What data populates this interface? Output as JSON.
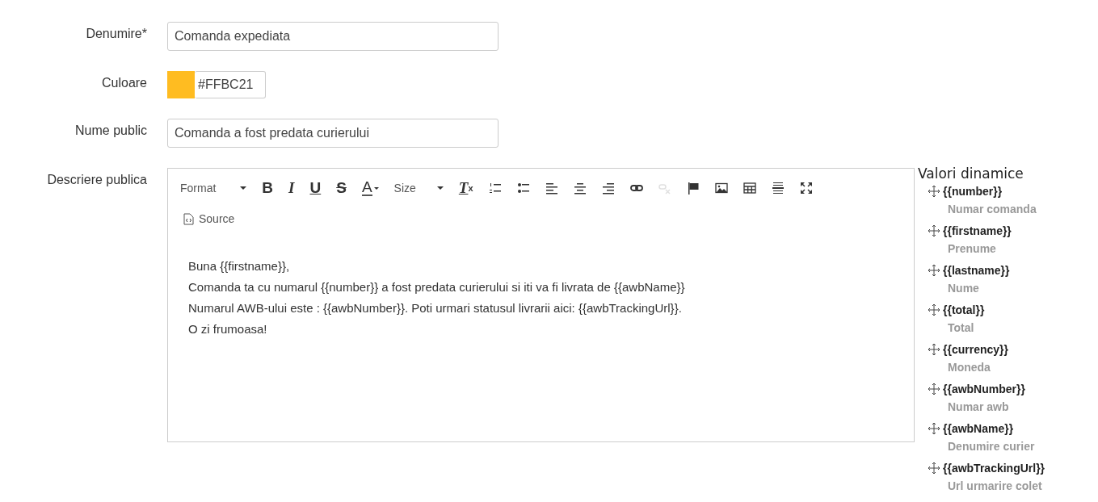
{
  "fields": [
    {
      "label": "Denumire*",
      "kind": "text",
      "value": "Comanda expediata"
    },
    {
      "label": "Culoare",
      "kind": "color",
      "color": "#ffbc21",
      "value": "#FFBC21"
    },
    {
      "label": "Nume public",
      "kind": "text",
      "value": "Comanda a fost predata curierului"
    },
    {
      "label": "Descriere publica",
      "kind": "editor"
    }
  ],
  "toolbar": [
    [
      {
        "kind": "dropdown",
        "label": "Format",
        "disabled": false
      },
      {
        "kind": "bold",
        "label": "B",
        "disabled": false
      },
      {
        "kind": "italic",
        "label": "I",
        "disabled": false
      },
      {
        "kind": "underline",
        "label": "U",
        "disabled": false
      },
      {
        "kind": "strike",
        "label": "S",
        "disabled": false
      },
      {
        "kind": "color",
        "label": "A",
        "disabled": false
      },
      {
        "kind": "dropdown",
        "label": "Size",
        "disabled": false
      },
      {
        "kind": "removeformat",
        "label": "T",
        "sub": "x",
        "disabled": false
      },
      {
        "kind": "numbered",
        "disabled": false
      },
      {
        "kind": "bulleted",
        "disabled": false
      },
      {
        "kind": "alignleft",
        "disabled": false
      },
      {
        "kind": "center",
        "disabled": false
      },
      {
        "kind": "alignright",
        "disabled": false
      },
      {
        "kind": "link",
        "disabled": false
      },
      {
        "kind": "unlink",
        "disabled": true
      },
      {
        "kind": "anchor",
        "disabled": false
      },
      {
        "kind": "image",
        "disabled": false
      },
      {
        "kind": "table",
        "disabled": false
      },
      {
        "kind": "hr",
        "disabled": false
      },
      {
        "kind": "maximize",
        "disabled": false
      }
    ],
    [
      {
        "kind": "source",
        "label": "Source",
        "disabled": false
      }
    ]
  ],
  "editor_lines": [
    "Buna {{firstname}},",
    "Comanda ta cu numarul {{number}} a fost predata curierului si iti va fi livrata de {{awbName}}",
    "Numarul AWB-ului este : {{awbNumber}}. Poti urmari statusul livrarii aici: {{awbTrackingUrl}}.",
    "O zi frumoasa!"
  ],
  "dynamic_values": {
    "title": "Valori dinamice",
    "items": [
      {
        "tag": "{{number}}",
        "description": "Numar comanda"
      },
      {
        "tag": "{{firstname}}",
        "description": "Prenume"
      },
      {
        "tag": "{{lastname}}",
        "description": "Nume"
      },
      {
        "tag": "{{total}}",
        "description": "Total"
      },
      {
        "tag": "{{currency}}",
        "description": "Moneda"
      },
      {
        "tag": "{{awbNumber}}",
        "description": "Numar awb"
      },
      {
        "tag": "{{awbName}}",
        "description": "Denumire curier"
      },
      {
        "tag": "{{awbTrackingUrl}}",
        "description": "Url urmarire colet"
      }
    ]
  }
}
